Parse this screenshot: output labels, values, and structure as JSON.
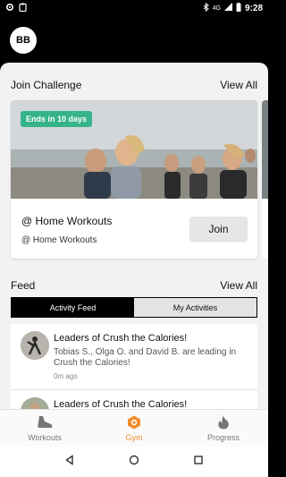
{
  "status_bar": {
    "time": "9:28",
    "network_label": "4G",
    "icons": [
      "gear-icon",
      "clipboard-icon",
      "bluetooth-icon",
      "signal-icon",
      "battery-icon"
    ]
  },
  "header": {
    "avatar_initials": "BB"
  },
  "join_challenge": {
    "title": "Join Challenge",
    "view_all": "View All",
    "card": {
      "badge": "Ends in 10 days",
      "title": "@ Home Workouts",
      "subtitle": "@ Home Workouts",
      "join_label": "Join"
    }
  },
  "feed": {
    "title": "Feed",
    "view_all": "View All",
    "tabs": [
      {
        "label": "Activity Feed",
        "active": true
      },
      {
        "label": "My Activities",
        "active": false
      }
    ],
    "items": [
      {
        "title": "Leaders of Crush the Calories!",
        "description": "Tobias S., Olga O. and David B. are leading in Crush the Calories!",
        "time": "0m ago"
      },
      {
        "title": "Leaders of Crush the Calories!",
        "description": "",
        "time": ""
      }
    ]
  },
  "bottom_nav": {
    "items": [
      {
        "label": "Workouts",
        "icon": "shoe-icon",
        "active": false
      },
      {
        "label": "Gym",
        "icon": "gym-icon",
        "active": true
      },
      {
        "label": "Progress",
        "icon": "flame-icon",
        "active": false
      }
    ]
  },
  "colors": {
    "accent": "#f28c28",
    "badge": "#37b38b",
    "header_bg": "#000000"
  }
}
